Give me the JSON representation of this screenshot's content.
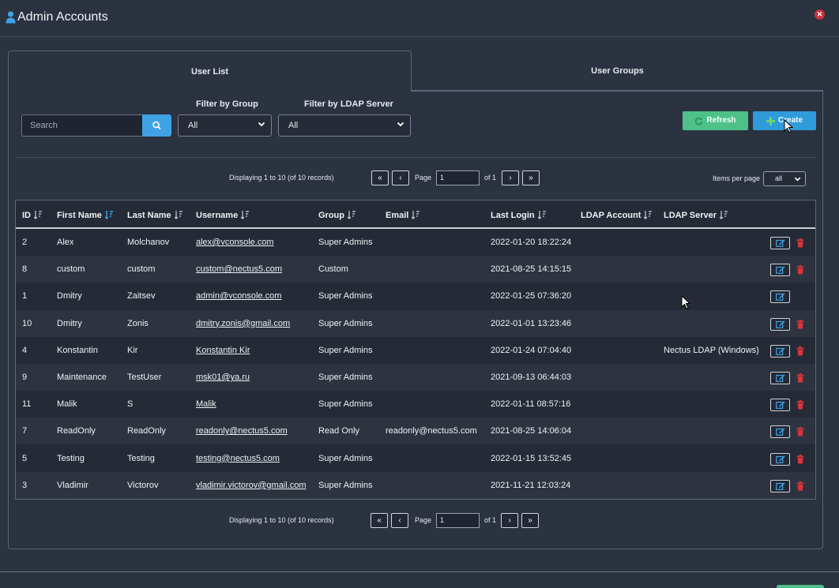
{
  "window": {
    "title": "Admin Accounts",
    "close_icon": "close-icon"
  },
  "tabs": [
    {
      "label": "User List",
      "active": true
    },
    {
      "label": "User Groups",
      "active": false
    }
  ],
  "filters": {
    "search_placeholder": "Search",
    "group_label": "Filter by Group",
    "group_value": "All",
    "ldap_label": "Filter by LDAP Server",
    "ldap_value": "All"
  },
  "actions": {
    "refresh_label": "Refresh",
    "create_label": "Create"
  },
  "pagination": {
    "display_text": "Displaying 1 to 10 (of 10 records)",
    "first": "«",
    "prev": "‹",
    "next": "›",
    "last": "»",
    "page_label": "Page",
    "page_value": "1",
    "of_text": "of 1",
    "items_per_page_label": "Items per page",
    "items_per_page_value": "all"
  },
  "table": {
    "columns": [
      "ID",
      "First Name",
      "Last Name",
      "Username",
      "Group",
      "Email",
      "Last Login",
      "LDAP Account",
      "LDAP Server"
    ],
    "rows": [
      {
        "id": "2",
        "first": "Alex",
        "last": "Molchanov",
        "username": "alex@vconsole.com",
        "group": "Super Admins",
        "email": "",
        "last_login": "2022-01-20 18:22:24",
        "ldap_account": "",
        "ldap_server": ""
      },
      {
        "id": "8",
        "first": "custom",
        "last": "custom",
        "username": "custom@nectus5.com",
        "group": "Custom",
        "email": "",
        "last_login": "2021-08-25 14:15:15",
        "ldap_account": "",
        "ldap_server": ""
      },
      {
        "id": "1",
        "first": "Dmitry",
        "last": "Zaitsev",
        "username": "admin@vconsole.com",
        "group": "Super Admins",
        "email": "",
        "last_login": "2022-01-25 07:36:20",
        "ldap_account": "",
        "ldap_server": ""
      },
      {
        "id": "10",
        "first": "Dmitry",
        "last": "Zonis",
        "username": "dmitry.zonis@gmail.com",
        "group": "Super Admins",
        "email": "",
        "last_login": "2022-01-01 13:23:46",
        "ldap_account": "",
        "ldap_server": ""
      },
      {
        "id": "4",
        "first": "Konstantin",
        "last": "Kir",
        "username": "Konstantin Kir",
        "group": "Super Admins",
        "email": "",
        "last_login": "2022-01-24 07:04:40",
        "ldap_account": "",
        "ldap_server": "Nectus LDAP (Windows)"
      },
      {
        "id": "9",
        "first": "Maintenance",
        "last": "TestUser",
        "username": "msk01@ya.ru",
        "group": "Super Admins",
        "email": "",
        "last_login": "2021-09-13 06:44:03",
        "ldap_account": "",
        "ldap_server": ""
      },
      {
        "id": "11",
        "first": "Malik",
        "last": "S",
        "username": "Malik",
        "group": "Super Admins",
        "email": "",
        "last_login": "2022-01-11 08:57:16",
        "ldap_account": "",
        "ldap_server": ""
      },
      {
        "id": "7",
        "first": "ReadOnly",
        "last": "ReadOnly",
        "username": "readonly@nectus5.com",
        "group": "Read Only",
        "email": "readonly@nectus5.com",
        "last_login": "2021-08-25 14:06:04",
        "ldap_account": "",
        "ldap_server": ""
      },
      {
        "id": "5",
        "first": "Testing",
        "last": "Testing",
        "username": "testing@nectus5.com",
        "group": "Super Admins",
        "email": "",
        "last_login": "2022-01-15 13:52:45",
        "ldap_account": "",
        "ldap_server": ""
      },
      {
        "id": "3",
        "first": "Vladimir",
        "last": "Victorov",
        "username": "vladimir.victorov@gmail.com",
        "group": "Super Admins",
        "email": "",
        "last_login": "2021-11-21 12:03:24",
        "ldap_account": "",
        "ldap_server": ""
      }
    ],
    "row_delete_visible": [
      true,
      true,
      false,
      true,
      true,
      true,
      true,
      true,
      true,
      true
    ]
  },
  "colors": {
    "accent_blue": "#2f9bd9",
    "accent_green": "#4ec189",
    "danger_red": "#d9343a",
    "background": "#2b3240"
  }
}
